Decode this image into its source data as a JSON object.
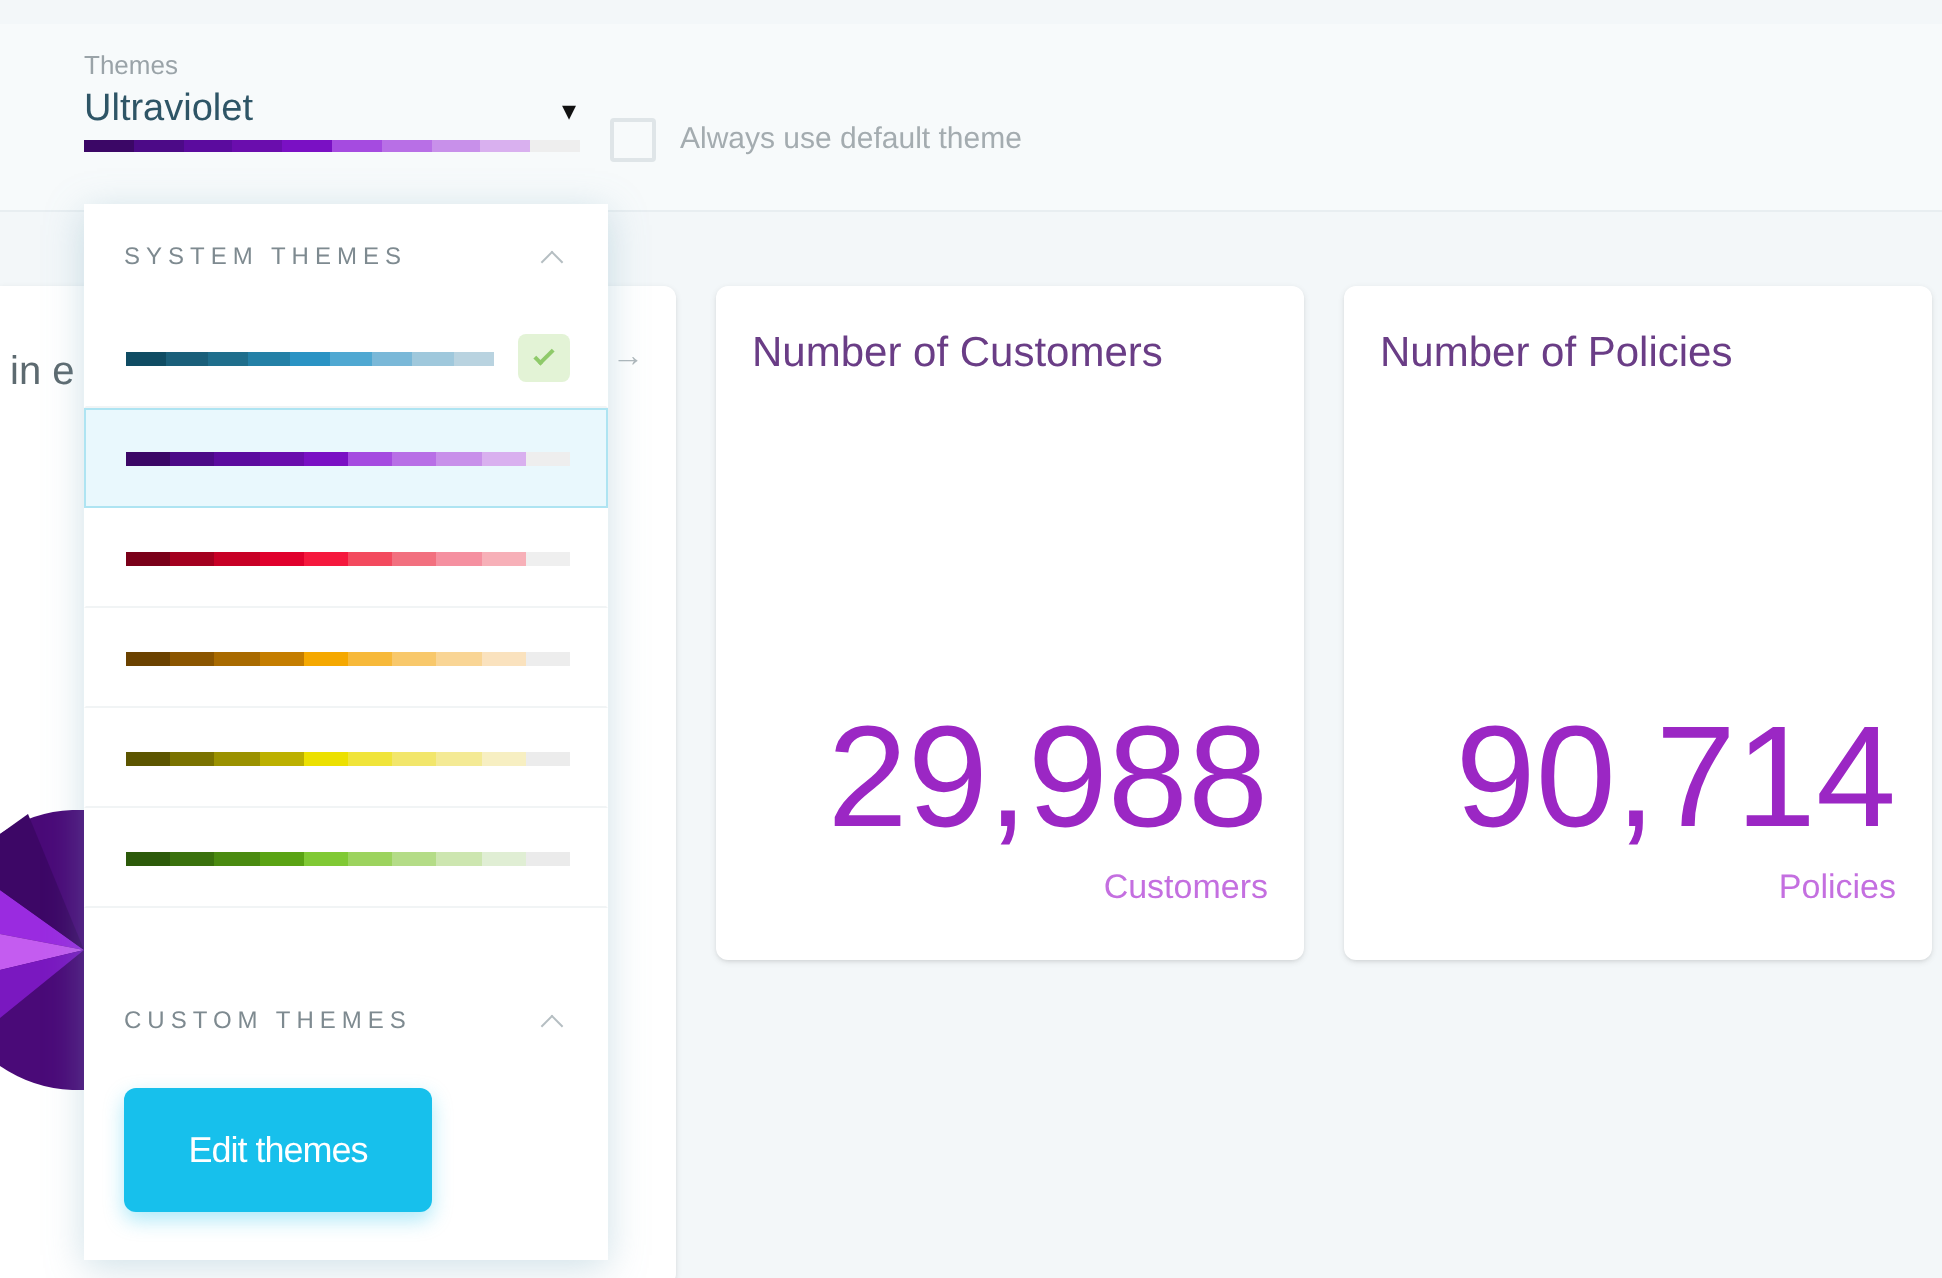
{
  "theme_select": {
    "label": "Themes",
    "value": "Ultraviolet",
    "caret": "▾"
  },
  "default_theme_checkbox": {
    "label": "Always use default theme",
    "checked": false
  },
  "menu": {
    "sections": [
      {
        "title": "SYSTEM THEMES",
        "expanded": true,
        "themes": [
          {
            "selected": false,
            "checked": true,
            "swatches": [
              {
                "color": "#0f4c63"
              },
              {
                "color": "#1a5f7a"
              },
              {
                "color": "#1f6e8c"
              },
              {
                "color": "#2480a6"
              },
              {
                "color": "#2a93c4"
              },
              {
                "color": "#4fa8d2"
              },
              {
                "color": "#7ab8d8"
              },
              {
                "color": "#9fc8dc"
              },
              {
                "color": "#b9d3e0"
              }
            ]
          },
          {
            "selected": true,
            "checked": false,
            "swatches": [
              {
                "color": "#3b0766"
              },
              {
                "color": "#4c0a87"
              },
              {
                "color": "#5b0b9e"
              },
              {
                "color": "#6a0dad"
              },
              {
                "color": "#7a10c4"
              },
              {
                "color": "#a54be0"
              },
              {
                "color": "#b86fe6"
              },
              {
                "color": "#c890ea"
              },
              {
                "color": "#d9b0ef"
              },
              {
                "color": "#eeeeee"
              }
            ]
          },
          {
            "selected": false,
            "checked": false,
            "swatches": [
              {
                "color": "#7a0019"
              },
              {
                "color": "#a3001f"
              },
              {
                "color": "#c70026"
              },
              {
                "color": "#e0002c"
              },
              {
                "color": "#f5183d"
              },
              {
                "color": "#f34a5e"
              },
              {
                "color": "#f2707f"
              },
              {
                "color": "#f590a0"
              },
              {
                "color": "#f7b0b8"
              },
              {
                "color": "#efefef"
              }
            ]
          },
          {
            "selected": false,
            "checked": false,
            "swatches": [
              {
                "color": "#6b4200"
              },
              {
                "color": "#8a5500"
              },
              {
                "color": "#a86a00"
              },
              {
                "color": "#c47d00"
              },
              {
                "color": "#f5a800"
              },
              {
                "color": "#f7b93a"
              },
              {
                "color": "#f8c86b"
              },
              {
                "color": "#f9d595"
              },
              {
                "color": "#fae2be"
              },
              {
                "color": "#ededed"
              }
            ]
          },
          {
            "selected": false,
            "checked": false,
            "swatches": [
              {
                "color": "#5c5500"
              },
              {
                "color": "#7a7200"
              },
              {
                "color": "#9a9100"
              },
              {
                "color": "#bcb000"
              },
              {
                "color": "#ece000"
              },
              {
                "color": "#f0e43a"
              },
              {
                "color": "#f2e66b"
              },
              {
                "color": "#f4ea95"
              },
              {
                "color": "#f7efc2"
              },
              {
                "color": "#ececec"
              }
            ]
          },
          {
            "selected": false,
            "checked": false,
            "swatches": [
              {
                "color": "#2c5a0a"
              },
              {
                "color": "#3a710d"
              },
              {
                "color": "#4a8a10"
              },
              {
                "color": "#5aa314"
              },
              {
                "color": "#80c934"
              },
              {
                "color": "#9cd35e"
              },
              {
                "color": "#b4dc87"
              },
              {
                "color": "#cde6b0"
              },
              {
                "color": "#e0eed4"
              },
              {
                "color": "#ebebeb"
              }
            ]
          }
        ]
      },
      {
        "title": "CUSTOM THEMES",
        "expanded": true
      }
    ],
    "button": "Edit themes"
  },
  "cards": [
    {
      "title": "in e",
      "arrow": "→"
    },
    {
      "title": "Number of Customers",
      "value": "29,988",
      "unit": "Customers"
    },
    {
      "title": "Number of Policies",
      "value": "90,714",
      "unit": "Policies"
    }
  ]
}
